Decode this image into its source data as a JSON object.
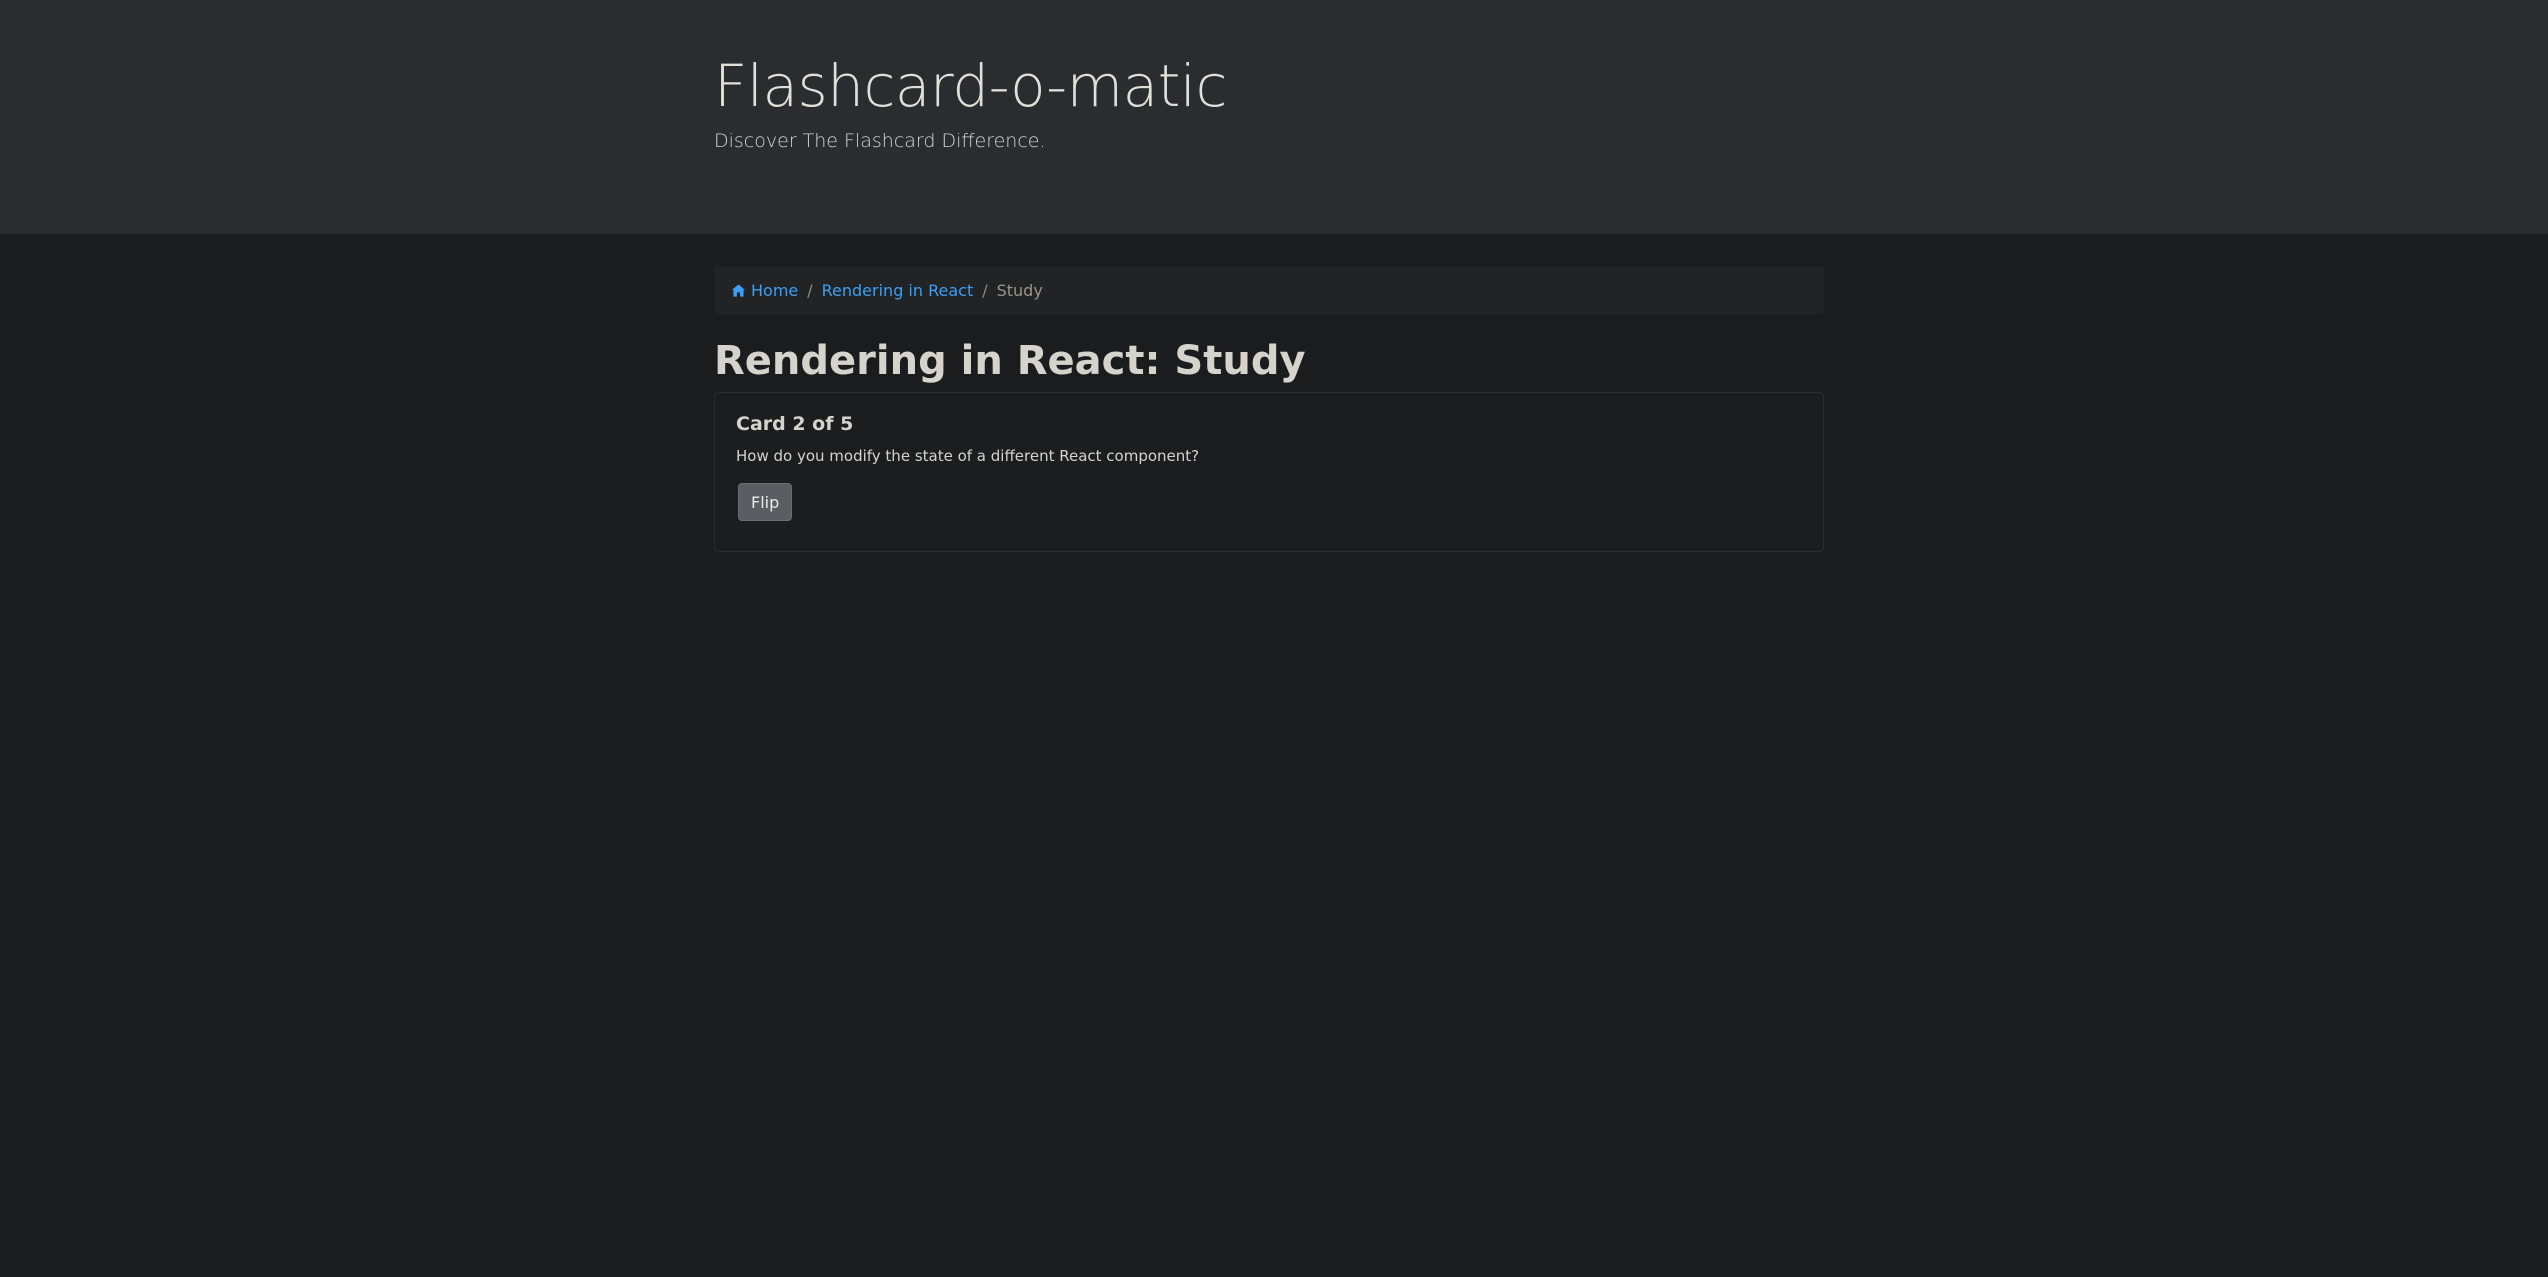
{
  "header": {
    "title": "Flashcard-o-matic",
    "tagline": "Discover The Flashcard Difference."
  },
  "breadcrumb": {
    "home_icon": "home-icon",
    "home_label": "Home",
    "deck_label": "Rendering in React",
    "current_label": "Study",
    "separator": "/"
  },
  "page": {
    "title": "Rendering in React: Study"
  },
  "card": {
    "title": "Card 2 of 5",
    "text": "How do you modify the state of a different React component?",
    "flip_label": "Flip"
  },
  "colors": {
    "link": "#3d9ff7",
    "header_bg": "#292d30",
    "page_bg": "#1b1c1e"
  }
}
